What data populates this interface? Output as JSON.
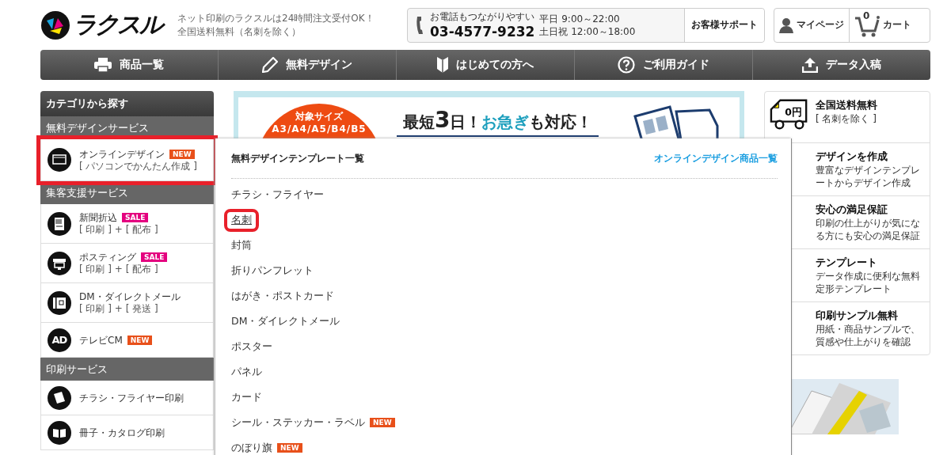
{
  "header": {
    "logo": "ラクスル",
    "tagline": [
      "ネット印刷のラクスルは24時間注文受付OK！",
      "全国送料無料（名刺を除く）"
    ],
    "phone": {
      "lead": "お電話もつながりやすい",
      "number": "03-4577-9232",
      "hours": [
        "平日 9:00～22:00",
        "土日祝 12:00～18:00"
      ]
    },
    "support": "お客様サポート",
    "mypage": "マイページ",
    "cart": {
      "count": "0",
      "label": "カート"
    }
  },
  "nav": [
    "商品一覧",
    "無料デザイン",
    "はじめての方へ",
    "ご利用ガイド",
    "データ入稿"
  ],
  "sidebar": {
    "title": "カテゴリから探す",
    "sections": [
      {
        "title": "無料デザインサービス",
        "items": [
          {
            "label": "オンラインデザイン",
            "sub": "[ パソコンでかんたん作成 ]",
            "badge": {
              "text": "NEW",
              "color": "#e8501a"
            },
            "highlighted": true
          }
        ]
      },
      {
        "title": "集客支援サービス",
        "items": [
          {
            "label": "新聞折込",
            "sub": "[ 印刷 ] + [ 配布 ]",
            "badge": {
              "text": "SALE",
              "color": "#e4007f"
            },
            "highlighted": false
          },
          {
            "label": "ポスティング",
            "sub": "[ 印刷 ] + [ 配布 ]",
            "badge": {
              "text": "SALE",
              "color": "#e4007f"
            },
            "highlighted": false
          },
          {
            "label": "DM・ダイレクトメール",
            "sub": "[ 印刷 ] + [ 発送 ]",
            "highlighted": false
          },
          {
            "label": "テレビCM",
            "icon_text": "AD",
            "badge": {
              "text": "NEW",
              "color": "#e8501a"
            },
            "highlighted": false
          }
        ]
      },
      {
        "title": "印刷サービス",
        "items": [
          {
            "label": "チラシ・フライヤー印刷",
            "highlighted": false
          },
          {
            "label": "冊子・カタログ印刷",
            "highlighted": false
          }
        ]
      }
    ]
  },
  "banner": {
    "size_label": "対象サイズ",
    "sizes": "A3/A4/A5/B4/B5",
    "headline": [
      {
        "text": "最短",
        "kind": "plain"
      },
      {
        "text": "3",
        "kind": "big"
      },
      {
        "text": "日！",
        "kind": "plain"
      },
      {
        "text": "お急ぎ",
        "kind": "accent"
      },
      {
        "text": "も対応！",
        "kind": "plain"
      }
    ]
  },
  "features": [
    {
      "title": "全国送料無料",
      "desc": "[ 名刺を除く ]",
      "icon_text": "0円"
    },
    {
      "title": "デザインを作成",
      "desc": "豊富なデザインテンプレートからデザイン作成"
    },
    {
      "title": "安心の満足保証",
      "desc": "印刷の仕上がりが気になる方にも安心の満足保証"
    },
    {
      "title": "テンプレート",
      "desc": "データ作成に便利な無料定形テンプレート"
    },
    {
      "title": "印刷サンプル無料",
      "desc": "用紙・商品サンプルで、質感や仕上がりを確認"
    }
  ],
  "dropdown": {
    "title": "無料デザインテンプレート一覧",
    "link": "オンラインデザイン商品一覧",
    "items": [
      {
        "label": "チラシ・フライヤー",
        "highlighted": false
      },
      {
        "label": "名刺",
        "highlighted": true
      },
      {
        "label": "封筒",
        "highlighted": false
      },
      {
        "label": "折りパンフレット",
        "highlighted": false
      },
      {
        "label": "はがき・ポストカード",
        "highlighted": false
      },
      {
        "label": "DM・ダイレクトメール",
        "highlighted": false
      },
      {
        "label": "ポスター",
        "highlighted": false
      },
      {
        "label": "パネル",
        "highlighted": false
      },
      {
        "label": "カード",
        "highlighted": false
      },
      {
        "label": "シール・ステッカー・ラベル",
        "badge": "NEW",
        "highlighted": false
      },
      {
        "label": "のぼり旗",
        "badge": "NEW",
        "highlighted": false
      }
    ]
  }
}
